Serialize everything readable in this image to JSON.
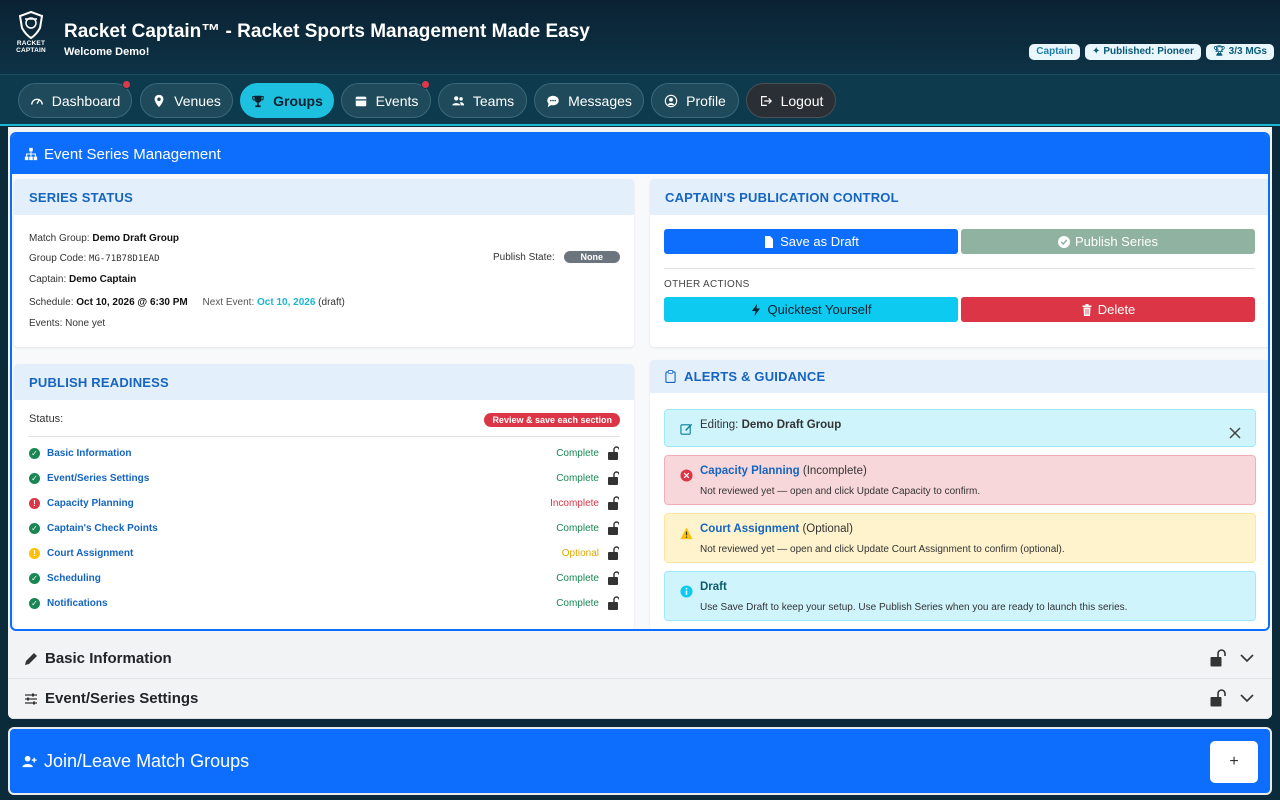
{
  "header": {
    "logo_text_1": "RACKET",
    "logo_text_2": "CAPTAIN",
    "title": "Racket Captain™ - Racket Sports Management Made Easy",
    "welcome": "Welcome Demo!",
    "badges": {
      "role": "Captain",
      "published": "Published: Pioneer",
      "mgs": "3/3 MGs"
    }
  },
  "nav": {
    "dashboard": "Dashboard",
    "venues": "Venues",
    "groups": "Groups",
    "events": "Events",
    "teams": "Teams",
    "messages": "Messages",
    "profile": "Profile",
    "logout": "Logout",
    "active": "Groups"
  },
  "series": {
    "title": "Event Series Management",
    "status": {
      "heading": "SERIES STATUS",
      "match_group_label": "Match Group:",
      "match_group": "Demo Draft Group",
      "group_code_label": "Group Code:",
      "group_code": "MG-71B78D1EAD",
      "publish_state_label": "Publish State:",
      "publish_state": "None",
      "captain_label": "Captain:",
      "captain": "Demo Captain",
      "schedule_label": "Schedule:",
      "schedule": "Oct 10, 2026 @ 6:30 PM",
      "next_event_label": "Next Event:",
      "next_event": "Oct 10, 2026",
      "next_event_suffix": "(draft)",
      "events_label": "Events:",
      "events": "None yet"
    },
    "control": {
      "heading": "CAPTAIN'S PUBLICATION CONTROL",
      "save_draft": "Save as Draft",
      "publish": "Publish Series",
      "other_actions": "OTHER ACTIONS",
      "quicktest": "Quicktest Yourself",
      "delete": "Delete"
    },
    "readiness": {
      "heading": "PUBLISH READINESS",
      "status_label": "Status:",
      "status_badge": "Review & save each section",
      "items": [
        {
          "label": "Basic Information",
          "status": "Complete"
        },
        {
          "label": "Event/Series Settings",
          "status": "Complete"
        },
        {
          "label": "Capacity Planning",
          "status": "Incomplete"
        },
        {
          "label": "Captain's Check Points",
          "status": "Complete"
        },
        {
          "label": "Court Assignment",
          "status": "Optional"
        },
        {
          "label": "Scheduling",
          "status": "Complete"
        },
        {
          "label": "Notifications",
          "status": "Complete"
        }
      ]
    },
    "alerts": {
      "heading": "ALERTS & GUIDANCE",
      "editing_label": "Editing:",
      "editing_name": "Demo Draft Group",
      "capacity_title": "Capacity Planning",
      "capacity_tag": "(Incomplete)",
      "capacity_desc": "Not reviewed yet — open and click Update Capacity to confirm.",
      "court_title": "Court Assignment",
      "court_tag": "(Optional)",
      "court_desc": "Not reviewed yet — open and click Update Court Assignment to confirm (optional).",
      "draft_title": "Draft",
      "draft_desc": "Use Save Draft to keep your setup. Use Publish Series when you are ready to launch this series."
    }
  },
  "sections": {
    "basic_info": "Basic Information",
    "event_settings": "Event/Series Settings"
  },
  "join": {
    "title": "Join/Leave Match Groups",
    "plus": "+"
  },
  "colors": {
    "primary": "#0d6efd",
    "teal": "#1ec0e0",
    "success": "#198754",
    "danger": "#dc3545",
    "warning": "#ffc107"
  }
}
